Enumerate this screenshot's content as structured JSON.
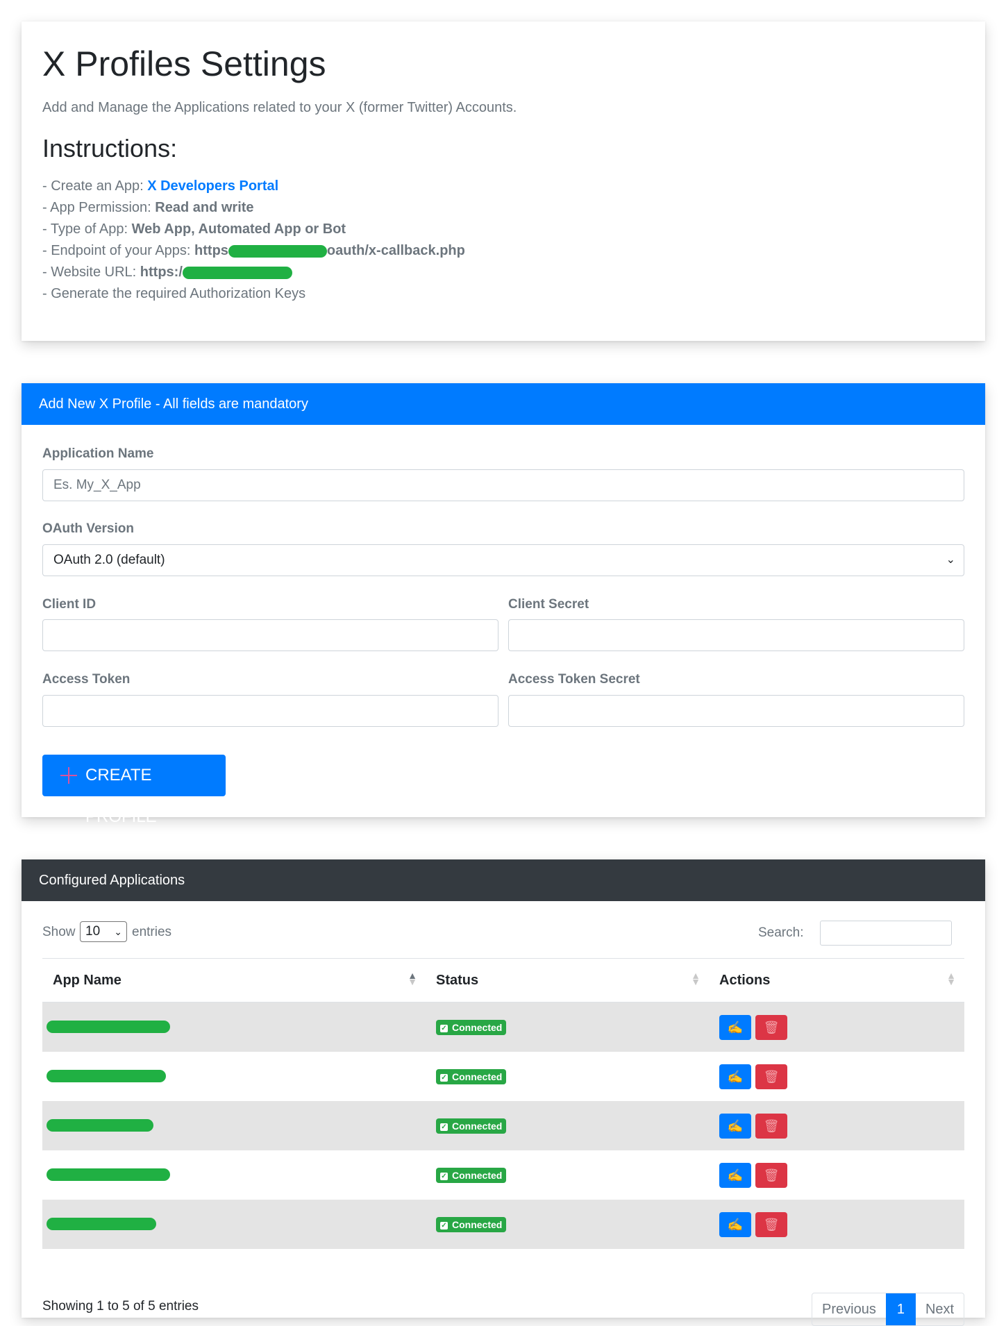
{
  "header": {
    "title": "X Profiles Settings",
    "subtitle": "Add and Manage the Applications related to your X (former Twitter) Accounts.",
    "instructions_title": "Instructions:",
    "instructions": {
      "create_prefix": "- Create an App: ",
      "create_link": "X Developers Portal",
      "permission_prefix": "- App Permission: ",
      "permission_value": "Read and write",
      "type_prefix": "- Type of App: ",
      "type_value": "Web App, Automated App or Bot",
      "endpoint_prefix": "- Endpoint of your Apps: ",
      "endpoint_start": "https",
      "endpoint_end": "oauth/x-callback.php",
      "website_prefix": "- Website URL: ",
      "website_start": "https:/",
      "generate": "- Generate the required Authorization Keys"
    }
  },
  "form": {
    "header": "Add New X Profile - All fields are mandatory",
    "app_name_label": "Application Name",
    "app_name_placeholder": "Es. My_X_App",
    "oauth_label": "OAuth Version",
    "oauth_selected": "OAuth 2.0 (default)",
    "client_id_label": "Client ID",
    "client_secret_label": "Client Secret",
    "access_token_label": "Access Token",
    "access_token_secret_label": "Access Token Secret",
    "create_button": "CREATE PROFILE"
  },
  "apps": {
    "header": "Configured Applications",
    "show_label": "Show",
    "entries_label": "entries",
    "page_length": "10",
    "search_label": "Search:",
    "columns": [
      "App Name",
      "Status",
      "Actions"
    ],
    "rows": [
      {
        "status": "Connected"
      },
      {
        "status": "Connected"
      },
      {
        "status": "Connected"
      },
      {
        "status": "Connected"
      },
      {
        "status": "Connected"
      }
    ],
    "info": "Showing 1 to 5 of 5 entries",
    "pagination": {
      "previous": "Previous",
      "current": "1",
      "next": "Next"
    }
  },
  "colors": {
    "primary": "#007bff",
    "dark": "#343a40",
    "success": "#28a745",
    "danger": "#dc3545",
    "redaction": "#20b043"
  }
}
